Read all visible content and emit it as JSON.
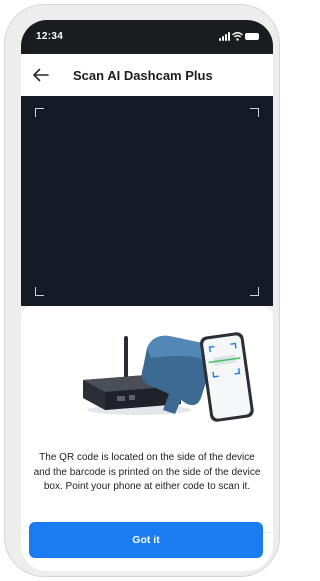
{
  "status_bar": {
    "time": "12:34"
  },
  "header": {
    "title": "Scan AI Dashcam Plus",
    "back_icon": "arrow-left-icon"
  },
  "scanner": {
    "corner_color": "#cfd3dc",
    "background": "#161a26"
  },
  "sheet": {
    "instruction": "The QR code is located on the side of the device and the barcode is printed on the side of the device box. Point your phone at either code to scan it."
  },
  "actions": {
    "confirm_label": "Got it",
    "accent_color": "#1a7cf0"
  }
}
